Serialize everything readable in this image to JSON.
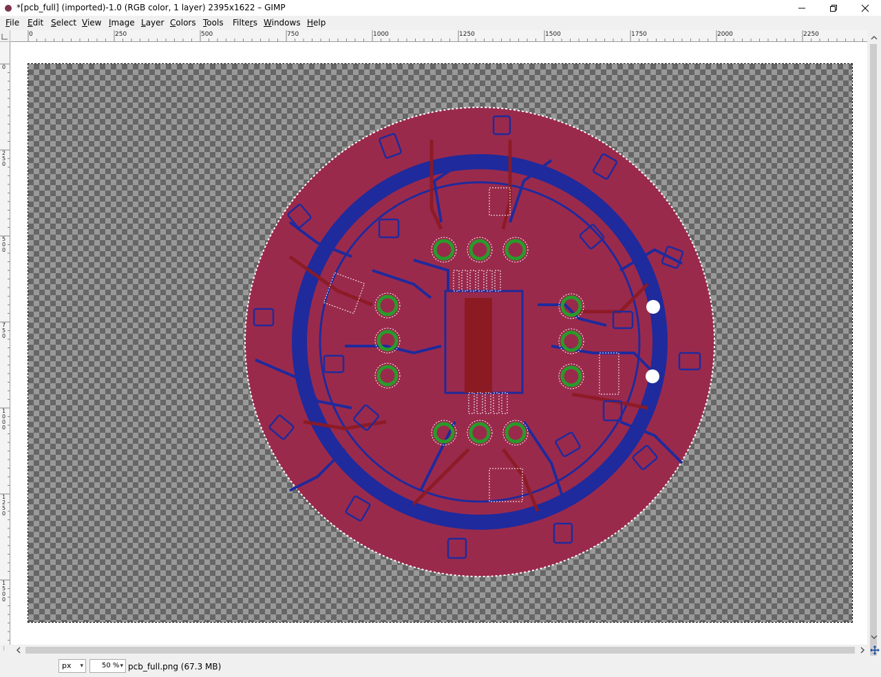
{
  "window": {
    "title": "*[pcb_full] (imported)-1.0 (RGB color, 1 layer) 2395x1622 – GIMP",
    "controls": {
      "minimize": "─",
      "maximize": "❐",
      "close": "✕"
    }
  },
  "menubar": {
    "items": [
      {
        "label": "File",
        "mnemonic": "F"
      },
      {
        "label": "Edit",
        "mnemonic": "E"
      },
      {
        "label": "Select",
        "mnemonic": "S"
      },
      {
        "label": "View",
        "mnemonic": "V"
      },
      {
        "label": "Image",
        "mnemonic": "I"
      },
      {
        "label": "Layer",
        "mnemonic": "L"
      },
      {
        "label": "Colors",
        "mnemonic": "C"
      },
      {
        "label": "Tools",
        "mnemonic": "T"
      },
      {
        "label": "Filters",
        "mnemonic": "r"
      },
      {
        "label": "Windows",
        "mnemonic": "W"
      },
      {
        "label": "Help",
        "mnemonic": "H"
      }
    ]
  },
  "rulers": {
    "horizontal": [
      "0",
      "250",
      "500",
      "750",
      "1000",
      "1250",
      "1500",
      "1750",
      "2000",
      "2250"
    ],
    "vertical": [
      "0",
      "250",
      "500",
      "750",
      "1000",
      "1250",
      "1500"
    ]
  },
  "statusbar": {
    "unit": "px",
    "zoom": "50 %",
    "file_info": "pcb_full.png (67.3 MB)"
  },
  "colors": {
    "board": "#9a2a4c",
    "copper_bottom": "#1f2a9c",
    "copper_top": "#8c1a22",
    "pads": "#2a9a2a",
    "checker_dark": "#666666",
    "checker_light": "#999999"
  },
  "icons": {
    "app": "gimp-wilber-icon",
    "grip": "resize-grip-icon",
    "navigate": "navigate-icon"
  }
}
